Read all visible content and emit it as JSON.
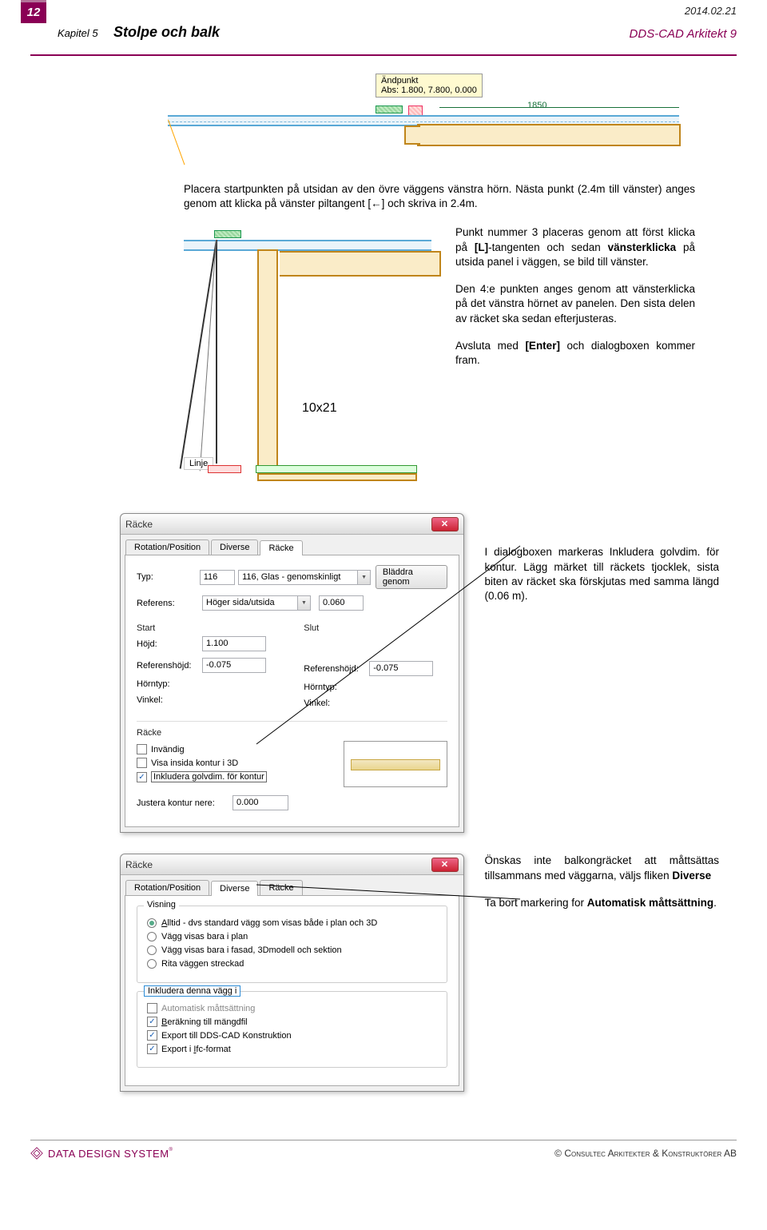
{
  "header": {
    "page_number": "12",
    "chapter": "Kapitel 5",
    "title": "Stolpe och balk",
    "date": "2014.02.21",
    "product": "DDS-CAD Arkitekt 9"
  },
  "fig1": {
    "flag_line1": "Ändpunkt",
    "flag_line2": "Abs: 1.800, 7.800, 0.000",
    "dim": "1850"
  },
  "para1": "Placera startpunkten på utsidan av den övre väggens vänstra hörn. Nästa punkt (2.4m till vänster) anges genom att klicka på vänster piltangent [←] och skriva in 2.4m.",
  "right": {
    "p1a": "Punkt nummer 3 placeras genom att först klicka på ",
    "p1b": "[L]",
    "p1c": "-tangenten och sedan ",
    "p1d": "vänsterklicka",
    "p1e": " på utsida panel i väggen, se bild till vänster.",
    "p2": "Den 4:e punkten anges genom att vänsterklicka på det vänstra hörnet av panelen. Den sista delen av räcket ska sedan efterjusteras.",
    "p3a": "Avsluta med ",
    "p3b": "[Enter]",
    "p3c": " och dialogboxen kommer fram."
  },
  "fig2": {
    "dim": "10x21",
    "linje": "Linje"
  },
  "dlg1": {
    "title": "Räcke",
    "tabs": [
      "Rotation/Position",
      "Diverse",
      "Räcke"
    ],
    "labels": {
      "typ": "Typ:",
      "referens": "Referens:",
      "start": "Start",
      "slut": "Slut",
      "hojd": "Höjd:",
      "refhojd": "Referenshöjd:",
      "horntyp": "Hörntyp:",
      "vinkel": "Vinkel:",
      "racke_section": "Räcke",
      "just": "Justera kontur nere:"
    },
    "values": {
      "typ_id": "116",
      "typ_name": "116, Glas - genomskinligt",
      "browse": "Bläddra genom",
      "referens": "Höger sida/utsida",
      "ref_val": "0.060",
      "hojd": "1.100",
      "refhojd1": "-0.075",
      "refhojd2": "-0.075",
      "just_val": "0.000"
    },
    "checks": {
      "c1": "Invändig",
      "c2": "Visa insida kontur i 3D",
      "c3": "Inkludera golvdim. för kontur"
    }
  },
  "side1": "I dialogboxen markeras Inkludera golvdim. för kontur. Lägg märket till räckets tjocklek, sista biten av räcket ska förskjutas med samma längd (0.06 m).",
  "dlg2": {
    "title": "Räcke",
    "tabs": [
      "Rotation/Position",
      "Diverse",
      "Räcke"
    ],
    "group_visning": "Visning",
    "radios": {
      "r1a": "Alltid - dvs standard vägg som visas både i plan och 3D",
      "r1u": "A",
      "r2": "Vägg visas bara i plan",
      "r3": "Vägg visas bara i fasad, 3Dmodell och sektion",
      "r4": "Rita väggen  streckad"
    },
    "group_ink": "Inkludera denna vägg i",
    "checks": {
      "c1": "Automatisk måttsättning",
      "c2": "Beräkning till mängdfil",
      "c2u": "B",
      "c3": "Export till DDS-CAD Konstruktion",
      "c4": "Export i Ifc-format",
      "c4u": "I"
    }
  },
  "side2": {
    "p1a": "Önskas inte balkongräcket att måttsättas tillsammans med väggarna, väljs fliken ",
    "p1b": "Diverse",
    "p2a": "Ta bort markering for ",
    "p2b": "Automatisk måttsättning",
    "p2c": "."
  },
  "footer": {
    "brand": "DATA DESIGN SYSTEM",
    "tm": "®",
    "copy_prefix": "©  ",
    "copy": "Consultec Arkitekter & Konstruktörer",
    "copy_suffix": " AB"
  }
}
